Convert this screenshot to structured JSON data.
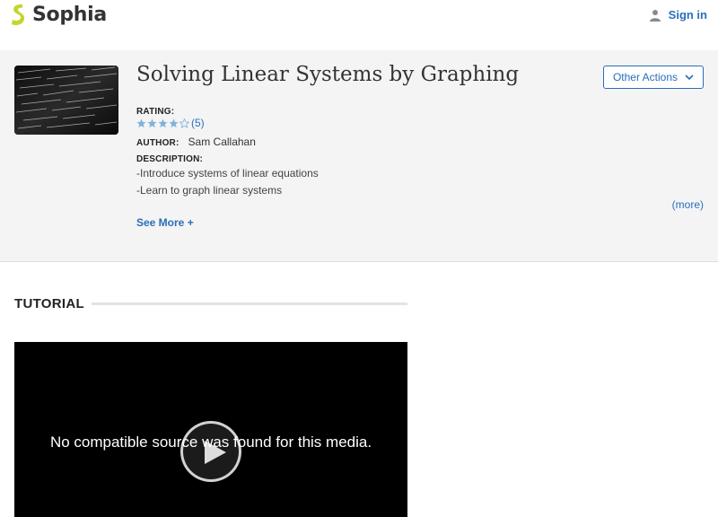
{
  "header": {
    "brand": "Sophia",
    "brand_color": "#c5d42e",
    "signin_label": "Sign in",
    "signin_icon": "user-icon"
  },
  "summary": {
    "title": "Solving Linear Systems by Graphing",
    "other_actions_label": "Other Actions",
    "rating_label": "RATING:",
    "rating_stars": 4,
    "rating_max": 5,
    "rating_count": "(5)",
    "author_label": "AUTHOR:",
    "author_name": "Sam Callahan",
    "description_label": "DESCRIPTION:",
    "description_lines": [
      "-Introduce systems of linear equations",
      "-Learn to graph linear systems"
    ],
    "more_label": "(more)",
    "see_more_label": "See More +"
  },
  "tutorial": {
    "heading": "TUTORIAL",
    "video_message": "No compatible source was found for this media."
  },
  "colors": {
    "link": "#2a6ebb",
    "band_bg": "#f4f4f4",
    "star_fill": "#7fb2dc"
  }
}
